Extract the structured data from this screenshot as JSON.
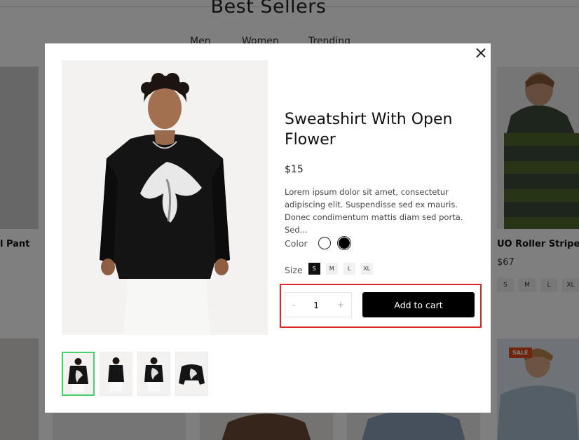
{
  "background": {
    "section_title": "Best Sellers",
    "tabs": [
      {
        "label": "Men"
      },
      {
        "label": "Women"
      },
      {
        "label": "Trending"
      }
    ],
    "left_card": {
      "name": "l Pant"
    },
    "right_card": {
      "name": "UO Roller Stripe Tee",
      "price": "$67",
      "sizes": [
        "S",
        "M",
        "L",
        "XL"
      ]
    },
    "sale_badge": "SALE"
  },
  "modal": {
    "title": "Sweatshirt With Open Flower",
    "price": "$15",
    "description": "Lorem ipsum dolor sit amet, consectetur adipiscing elit. Suspendisse sed ex mauris. Donec condimentum mattis diam sed porta. Sed...",
    "color_label": "Color",
    "colors": [
      {
        "name": "white",
        "hex": "#ffffff"
      },
      {
        "name": "black",
        "hex": "#000000"
      }
    ],
    "size_label": "Size",
    "sizes": [
      {
        "label": "S",
        "selected": true
      },
      {
        "label": "M",
        "selected": false
      },
      {
        "label": "L",
        "selected": false
      },
      {
        "label": "XL",
        "selected": false
      }
    ],
    "quantity": "1",
    "minus": "-",
    "plus": "+",
    "add_to_cart": "Add to cart",
    "thumbnail_count": 4,
    "accent_selected_thumb": "#4ad06a",
    "highlight_color": "#e02424"
  }
}
